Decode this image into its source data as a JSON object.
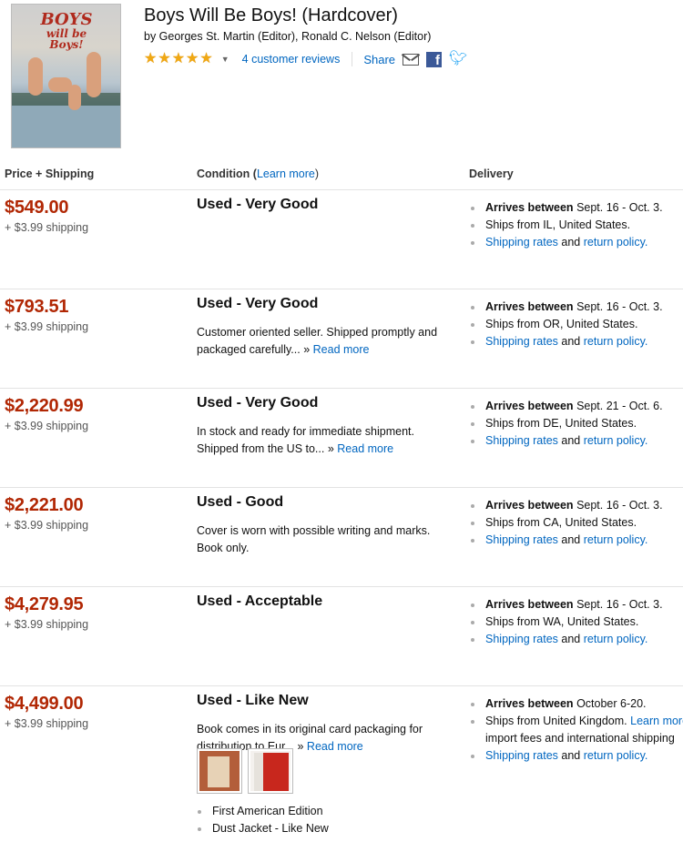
{
  "product": {
    "cover_text": [
      "BOYS",
      "will be",
      "Boys!"
    ],
    "title": "Boys Will Be Boys! (Hardcover)",
    "byline": "by Georges St. Martin (Editor), Ronald C. Nelson (Editor)",
    "rating": 5,
    "reviews_label": "4 customer reviews",
    "share_label": "Share"
  },
  "columns": {
    "price": "Price + Shipping",
    "condition": "Condition (",
    "learn_more": "Learn more",
    "condition_close": ")",
    "delivery": "Delivery"
  },
  "colors": {
    "price": "#b12704",
    "link": "#0066c0",
    "star": "#f0a814"
  },
  "offers": [
    {
      "price": "$549.00",
      "shipping": "+ $3.99 shipping",
      "condition": "Used - Very Good",
      "comment": "",
      "read_more": "",
      "arrives_label": "Arrives between",
      "arrives": "Sept. 16 - Oct. 3.",
      "ships_from": "Ships from IL, United States.",
      "rates_link": "Shipping rates",
      "and_text": "and",
      "policy_link": "return policy."
    },
    {
      "price": "$793.51",
      "shipping": "+ $3.99 shipping",
      "condition": "Used - Very Good",
      "comment": "Customer oriented seller. Shipped promptly and packaged carefully... »",
      "read_more": "Read more",
      "arrives_label": "Arrives between",
      "arrives": "Sept. 16 - Oct. 3.",
      "ships_from": "Ships from OR, United States.",
      "rates_link": "Shipping rates",
      "and_text": "and",
      "policy_link": "return policy."
    },
    {
      "price": "$2,220.99",
      "shipping": "+ $3.99 shipping",
      "condition": "Used - Very Good",
      "comment": "In stock and ready for immediate shipment. Shipped from the US to... »",
      "read_more": "Read more",
      "arrives_label": "Arrives between",
      "arrives": "Sept. 21 - Oct. 6.",
      "ships_from": "Ships from DE, United States.",
      "rates_link": "Shipping rates",
      "and_text": "and",
      "policy_link": "return policy."
    },
    {
      "price": "$2,221.00",
      "shipping": "+ $3.99 shipping",
      "condition": "Used - Good",
      "comment": "Cover is worn with possible writing and marks. Book only.",
      "read_more": "",
      "arrives_label": "Arrives between",
      "arrives": "Sept. 16 - Oct. 3.",
      "ships_from": "Ships from CA, United States.",
      "rates_link": "Shipping rates",
      "and_text": "and",
      "policy_link": "return policy."
    },
    {
      "price": "$4,279.95",
      "shipping": "+ $3.99 shipping",
      "condition": "Used - Acceptable",
      "comment": "",
      "read_more": "",
      "arrives_label": "Arrives between",
      "arrives": "Sept. 16 - Oct. 3.",
      "ships_from": "Ships from WA, United States.",
      "rates_link": "Shipping rates",
      "and_text": "and",
      "policy_link": "return policy."
    },
    {
      "price": "$4,499.00",
      "shipping": "+ $3.99 shipping",
      "condition": "Used - Like New",
      "comment": "Book comes in its original card packaging for distribution to Eur... »",
      "read_more": "Read more",
      "arrives_label": "Arrives between",
      "arrives": "October 6-20.",
      "ships_from": "Ships from United Kingdom.",
      "learn_more": "Learn more",
      "import_fees": "import fees and international shipping",
      "rates_link": "Shipping rates",
      "and_text": "and",
      "policy_link": "return policy.",
      "features": [
        "First American Edition",
        "Dust Jacket - Like New"
      ]
    }
  ]
}
